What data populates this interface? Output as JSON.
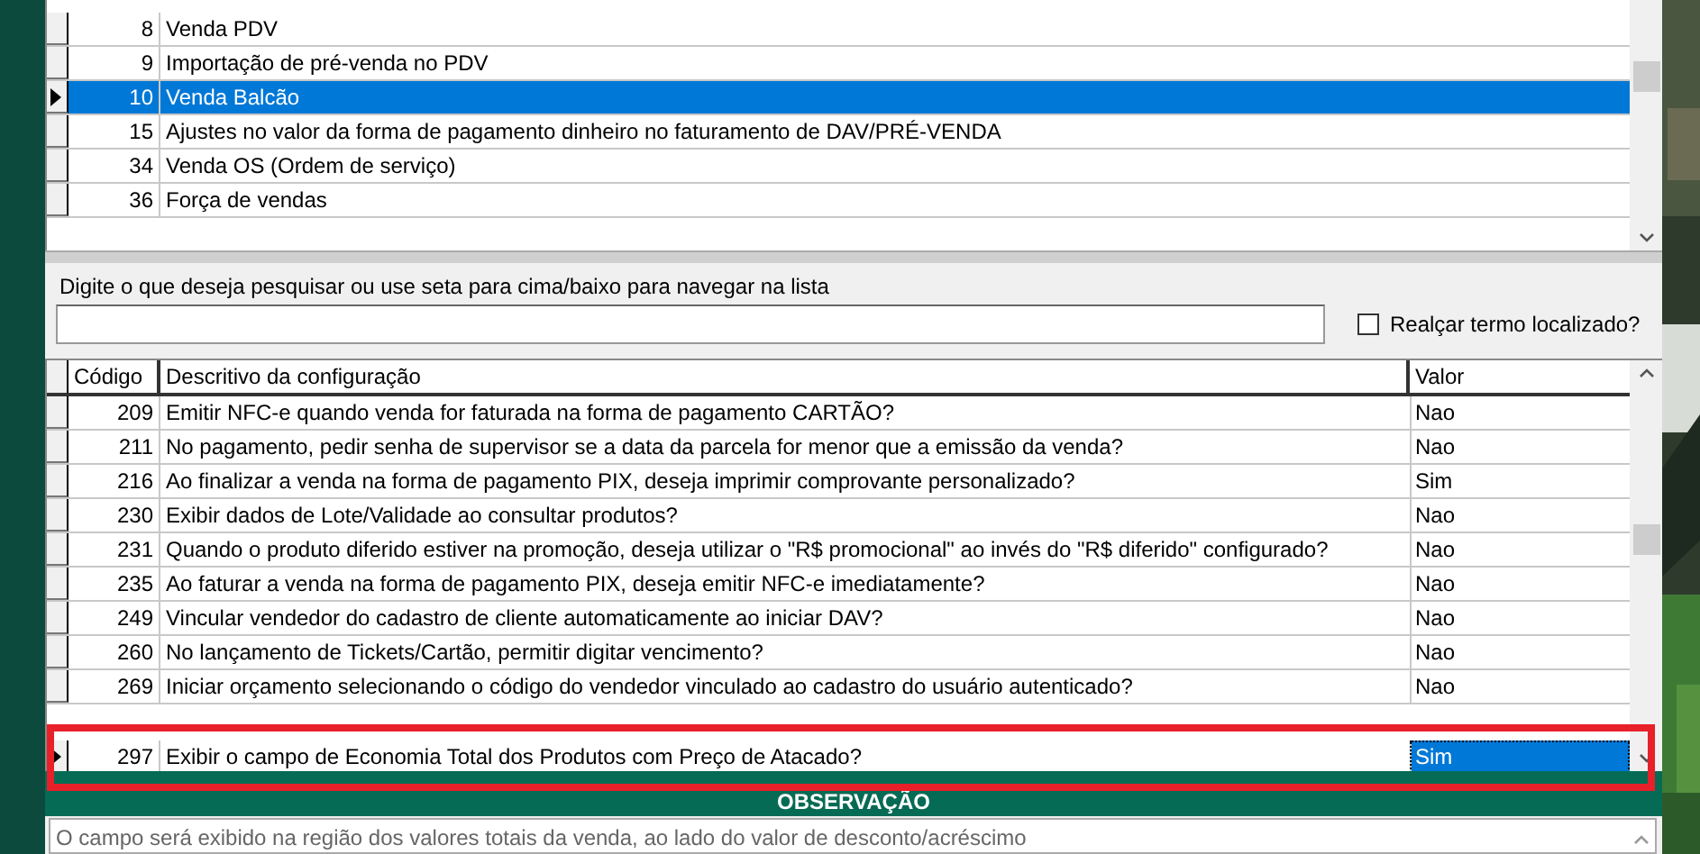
{
  "top_grid": {
    "rows": [
      {
        "code": "8",
        "description": "Venda PDV",
        "selected": false
      },
      {
        "code": "9",
        "description": "Importação de pré-venda no PDV",
        "selected": false
      },
      {
        "code": "10",
        "description": "Venda Balcão",
        "selected": true
      },
      {
        "code": "15",
        "description": "Ajustes no valor da forma de pagamento dinheiro no faturamento de DAV/PRÉ-VENDA",
        "selected": false
      },
      {
        "code": "34",
        "description": "Venda OS (Ordem de serviço)",
        "selected": false
      },
      {
        "code": "36",
        "description": "Força de vendas",
        "selected": false
      }
    ]
  },
  "search": {
    "label": "Digite o que deseja pesquisar ou use seta para cima/baixo para navegar na lista",
    "highlight_checkbox": {
      "label": "Realçar termo localizado?",
      "checked": false
    }
  },
  "config_grid": {
    "columns": [
      "Código",
      "Descritivo da configuração",
      "Valor"
    ],
    "rows": [
      {
        "code": "209",
        "description": "Emitir NFC-e quando venda for faturada na forma de pagamento CARTÃO?",
        "value": "Nao",
        "selected": false
      },
      {
        "code": "211",
        "description": "No pagamento, pedir senha de supervisor se a data da parcela for menor que a emissão da venda?",
        "value": "Nao",
        "selected": false
      },
      {
        "code": "216",
        "description": "Ao finalizar a venda na forma de pagamento PIX, deseja imprimir comprovante personalizado?",
        "value": "Sim",
        "selected": false
      },
      {
        "code": "230",
        "description": "Exibir dados de Lote/Validade ao consultar produtos?",
        "value": "Nao",
        "selected": false
      },
      {
        "code": "231",
        "description": "Quando o produto diferido estiver na promoção, deseja utilizar o \"R$ promocional\" ao invés do \"R$ diferido\" configurado?",
        "value": "Nao",
        "selected": false
      },
      {
        "code": "235",
        "description": "Ao faturar a venda na forma de pagamento PIX, deseja emitir NFC-e imediatamente?",
        "value": "Nao",
        "selected": false
      },
      {
        "code": "249",
        "description": "Vincular vendedor do cadastro de cliente automaticamente ao iniciar DAV?",
        "value": "Nao",
        "selected": false
      },
      {
        "code": "260",
        "description": "No lançamento de Tickets/Cartão, permitir digitar vencimento?",
        "value": "Nao",
        "selected": false
      },
      {
        "code": "269",
        "description": "Iniciar orçamento selecionando o código do vendedor vinculado ao cadastro do usuário autenticado?",
        "value": "Nao",
        "selected": false
      },
      {
        "code": "297",
        "description": "Exibir o campo de Economia Total dos Produtos com Preço de Atacado?",
        "value": "Sim",
        "selected": true
      }
    ]
  },
  "observation": {
    "title": "OBSERVAÇÃO",
    "text": "O campo será exibido na região dos valores totais da venda, ao lado do valor de desconto/acréscimo"
  }
}
